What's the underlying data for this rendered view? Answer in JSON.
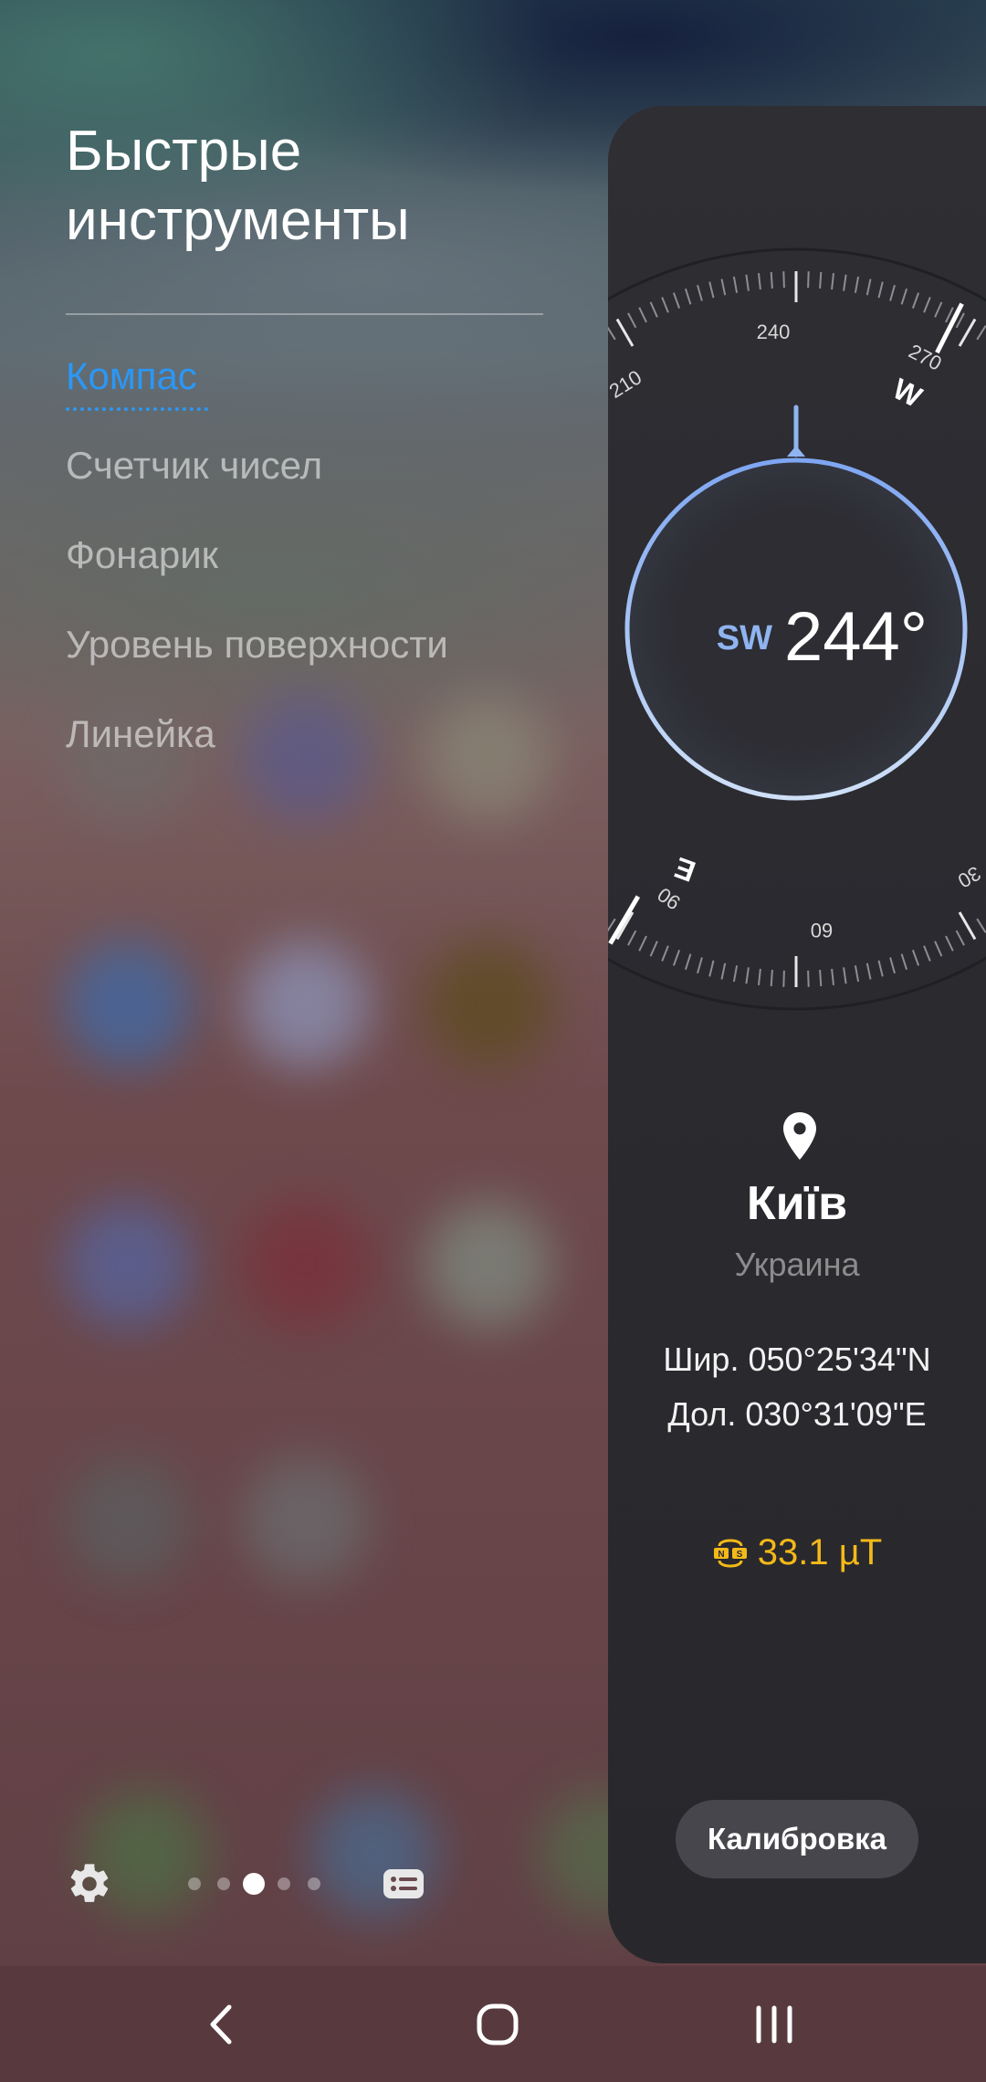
{
  "panel": {
    "title_line1": "Быстрые",
    "title_line2": "инструменты",
    "menu": [
      {
        "label": "Компас",
        "active": true
      },
      {
        "label": "Счетчик чисел",
        "active": false
      },
      {
        "label": "Фонарик",
        "active": false
      },
      {
        "label": "Уровень поверхности",
        "active": false
      },
      {
        "label": "Линейка",
        "active": false
      }
    ],
    "page_indicator": {
      "total": 5,
      "current": 3
    }
  },
  "compass": {
    "heading_dir": "SW",
    "heading_deg": "244°",
    "heading_value": 244,
    "dial_labels": {
      "l210": "210",
      "l240": "240",
      "l270": "270",
      "lW": "W",
      "lE": "E",
      "l90": "90",
      "l60": "60",
      "l30": "30"
    },
    "accent_color": "#8fb4f0"
  },
  "location": {
    "city": "Київ",
    "country": "Украина",
    "lat": "Шир. 050°25'34\"N",
    "lon": "Дол. 030°31'09\"E"
  },
  "magnetic": {
    "value": "33.1 µT",
    "icon": "magnet-ns-icon",
    "color": "#f4b918"
  },
  "calibrate_label": "Калибровка",
  "icons": {
    "settings": "gear-icon",
    "list": "list-icon",
    "back": "back-icon",
    "home": "home-icon",
    "recents": "recents-icon"
  }
}
